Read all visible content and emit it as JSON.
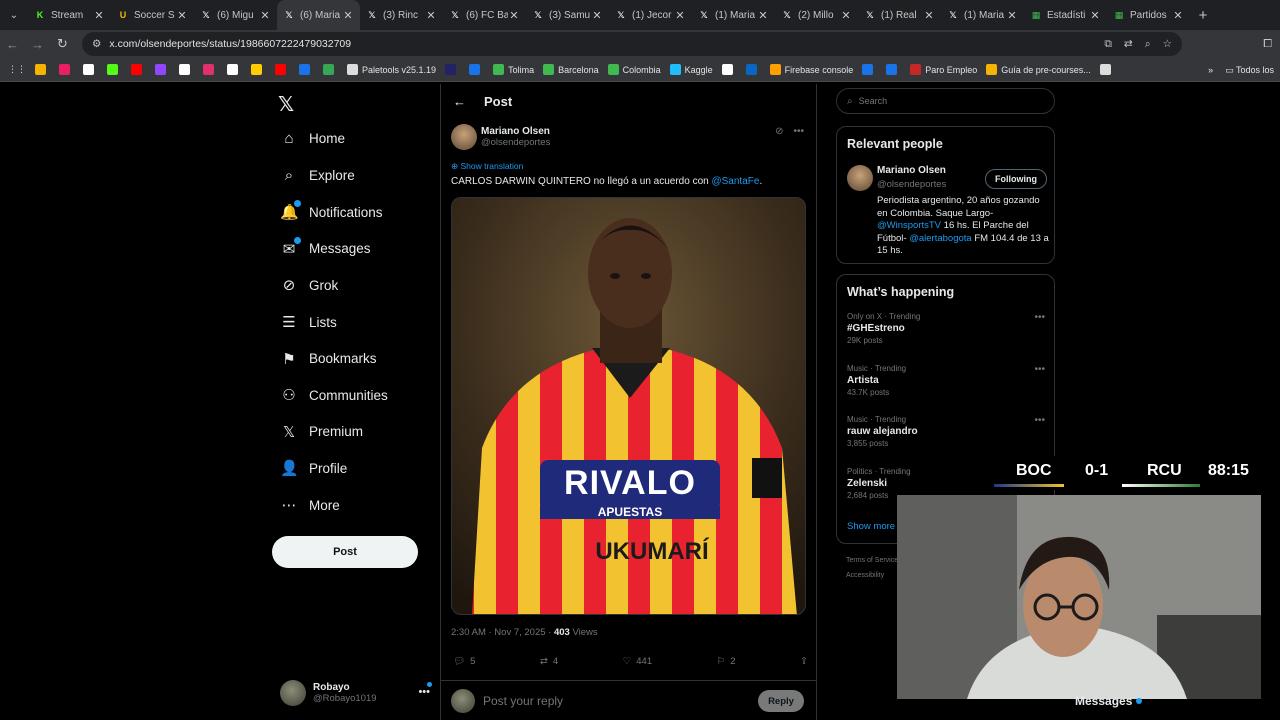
{
  "browser": {
    "tabs": [
      {
        "title": "Stream",
        "icon": "k-icon",
        "color": "#53fc18",
        "glyph": "K"
      },
      {
        "title": "Soccer S",
        "icon": "u-icon",
        "color": "#f7b500",
        "glyph": "U"
      },
      {
        "title": "(6) Migu",
        "icon": "x-icon",
        "color": "#ffffff",
        "glyph": "𝕏"
      },
      {
        "title": "(6) Maria",
        "icon": "x-icon",
        "color": "#ffffff",
        "glyph": "𝕏",
        "active": true
      },
      {
        "title": "(3) Rinc",
        "icon": "x-icon",
        "color": "#ffffff",
        "glyph": "𝕏"
      },
      {
        "title": "(6) FC Ba",
        "icon": "x-icon",
        "color": "#ffffff",
        "glyph": "𝕏"
      },
      {
        "title": "(3) Samu",
        "icon": "x-icon",
        "color": "#ffffff",
        "glyph": "𝕏"
      },
      {
        "title": "(1) Jecor",
        "icon": "x-icon",
        "color": "#ffffff",
        "glyph": "𝕏"
      },
      {
        "title": "(1) Maria",
        "icon": "x-icon",
        "color": "#ffffff",
        "glyph": "𝕏"
      },
      {
        "title": "(2) Millo",
        "icon": "x-icon",
        "color": "#ffffff",
        "glyph": "𝕏"
      },
      {
        "title": "(1) Real",
        "icon": "x-icon",
        "color": "#ffffff",
        "glyph": "𝕏"
      },
      {
        "title": "(1) Maria",
        "icon": "x-icon",
        "color": "#ffffff",
        "glyph": "𝕏"
      },
      {
        "title": "Estadísti",
        "icon": "green-sheet-icon",
        "color": "#3fb950",
        "glyph": "▦"
      },
      {
        "title": "Partidos",
        "icon": "green-sheet-icon",
        "color": "#3fb950",
        "glyph": "▦"
      }
    ],
    "url": "x.com/olsendeportes/status/1986607222479032709",
    "bookmarks": [
      {
        "label": "",
        "color": "#f4b400"
      },
      {
        "label": "",
        "color": "#e91e63"
      },
      {
        "label": "",
        "color": "#ffffff"
      },
      {
        "label": "",
        "color": "#53fc18"
      },
      {
        "label": "",
        "color": "#ff0000"
      },
      {
        "label": "",
        "color": "#9146ff"
      },
      {
        "label": "",
        "color": "#ffffff"
      },
      {
        "label": "",
        "color": "#e1306c"
      },
      {
        "label": "",
        "color": "#ffffff"
      },
      {
        "label": "",
        "color": "#ffcc00"
      },
      {
        "label": "",
        "color": "#ff0000"
      },
      {
        "label": "",
        "color": "#1a73e8"
      },
      {
        "label": "",
        "color": "#34a853"
      },
      {
        "label": "Paletools v25.1.19",
        "color": "#dddddd"
      },
      {
        "label": "",
        "color": "#222266"
      },
      {
        "label": "",
        "color": "#1a73e8"
      },
      {
        "label": "Tolima",
        "color": "#3fb950"
      },
      {
        "label": "Barcelona",
        "color": "#3fb950"
      },
      {
        "label": "Colombia",
        "color": "#3fb950"
      },
      {
        "label": "Kaggle",
        "color": "#20beff"
      },
      {
        "label": "",
        "color": "#ffffff"
      },
      {
        "label": "",
        "color": "#0a66c2"
      },
      {
        "label": "Firebase console",
        "color": "#ffa000"
      },
      {
        "label": "",
        "color": "#1a73e8"
      },
      {
        "label": "",
        "color": "#1a73e8"
      },
      {
        "label": "Paro Empleo",
        "color": "#c62828"
      },
      {
        "label": "Guía de pre-courses...",
        "color": "#f4b400"
      },
      {
        "label": "",
        "color": "#dddddd"
      }
    ],
    "all_bookmarks": "Todos los"
  },
  "nav": {
    "items": [
      {
        "label": "Home",
        "icon": "home-icon",
        "glyph": "⌂"
      },
      {
        "label": "Explore",
        "icon": "search-icon",
        "glyph": "⌕"
      },
      {
        "label": "Notifications",
        "icon": "bell-icon",
        "glyph": "🔔",
        "dot": true
      },
      {
        "label": "Messages",
        "icon": "mail-icon",
        "glyph": "✉",
        "dot": true
      },
      {
        "label": "Grok",
        "icon": "grok-icon",
        "glyph": "⊘"
      },
      {
        "label": "Lists",
        "icon": "list-icon",
        "glyph": "☰"
      },
      {
        "label": "Bookmarks",
        "icon": "bookmark-icon",
        "glyph": "⚑"
      },
      {
        "label": "Communities",
        "icon": "communities-icon",
        "glyph": "⚇"
      },
      {
        "label": "Premium",
        "icon": "x-icon",
        "glyph": "𝕏"
      },
      {
        "label": "Profile",
        "icon": "profile-icon",
        "glyph": "👤"
      },
      {
        "label": "More",
        "icon": "more-circle-icon",
        "glyph": "⋯"
      }
    ],
    "post_label": "Post",
    "user_name": "Robayo",
    "user_handle": "@Robayo1019"
  },
  "post": {
    "header_title": "Post",
    "author_name": "Mariano Olsen",
    "author_handle": "@olsendeportes",
    "translate_label": "Show translation",
    "text_before": "CARLOS DARWIN QUINTERO no llegó a un acuerdo con ",
    "text_mention": "@SantaFe",
    "text_after": ".",
    "shirt_sponsor": "RIVALO",
    "shirt_sponsor_sub": "APUESTAS",
    "shirt_sponsor_2": "UKUMARÍ",
    "time": "2:30 AM · Nov 7, 2025 · ",
    "views_count": "403",
    "views_label": " Views",
    "replies": "5",
    "reposts": "4",
    "likes": "441",
    "bookmarks": "2",
    "reply_placeholder": "Post your reply",
    "reply_button": "Reply"
  },
  "sidebar": {
    "search_placeholder": "Search",
    "relevant_title": "Relevant people",
    "person": {
      "name": "Mariano Olsen",
      "handle": "@olsendeportes",
      "follow_label": "Following",
      "bio_1": "Periodista argentino, 20 años gozando en Colombia. Saque Largo- ",
      "bio_mention_1": "@WinsportsTV",
      "bio_2": " 16 hs. El Parche del Fútbol- ",
      "bio_mention_2": "@alertabogota",
      "bio_3": " FM 104.4 de 13 a 15 hs."
    },
    "happening_title": "What’s happening",
    "trends": [
      {
        "context": "Only on X · Trending",
        "title": "#GHEstreno",
        "count": "29K posts"
      },
      {
        "context": "Music · Trending",
        "title": "Artista",
        "count": "43.7K posts"
      },
      {
        "context": "Music · Trending",
        "title": "rauw alejandro",
        "count": "3,855 posts"
      },
      {
        "context": "Politics · Trending",
        "title": "Zelenski",
        "count": "2,684 posts"
      }
    ],
    "show_more": "Show more",
    "footer_1": "Terms of Service",
    "footer_2": "Accessibility"
  },
  "overlay": {
    "home_team": "BOC",
    "score": "0-1",
    "away_team": "RCU",
    "clock": "88:15",
    "messages_dock": "Messages"
  }
}
